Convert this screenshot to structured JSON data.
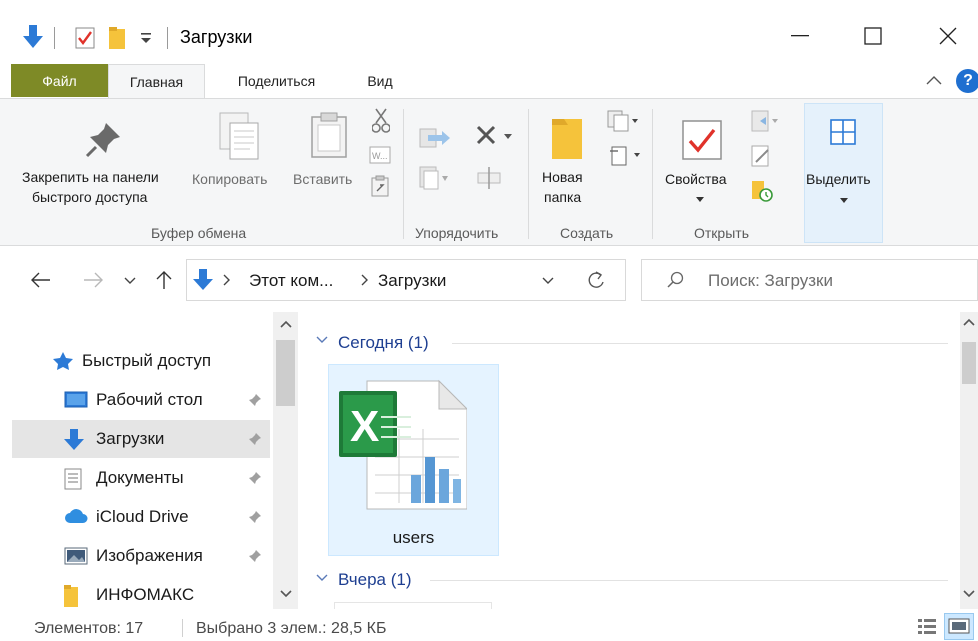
{
  "window": {
    "title": "Загрузки"
  },
  "quick_access_toolbar": {
    "items": [
      "properties-icon",
      "new-folder-icon",
      "customize-chevron-icon"
    ]
  },
  "tabs": [
    {
      "label": "Файл",
      "active": false,
      "accent": "#7e8a26"
    },
    {
      "label": "Главная",
      "active": true
    },
    {
      "label": "Поделиться",
      "active": false
    },
    {
      "label": "Вид",
      "active": false
    }
  ],
  "ribbon": {
    "clipboard": {
      "group_label": "Буфер обмена",
      "pin_label_1": "Закрепить на панели",
      "pin_label_2": "быстрого доступа",
      "copy_label": "Копировать",
      "paste_label": "Вставить"
    },
    "organize": {
      "group_label": "Упорядочить"
    },
    "new": {
      "group_label": "Создать",
      "new_folder_label_1": "Новая",
      "new_folder_label_2": "папка"
    },
    "open": {
      "group_label": "Открыть",
      "properties_label": "Свойства"
    },
    "select": {
      "select_label": "Выделить"
    }
  },
  "address": {
    "crumbs": [
      "Этот ком...",
      "Загрузки"
    ],
    "search_placeholder": "Поиск: Загрузки"
  },
  "nav_pane": {
    "quick_access": "Быстрый доступ",
    "items": [
      {
        "label": "Рабочий стол",
        "icon": "desktop-icon",
        "pinned": true,
        "selected": false
      },
      {
        "label": "Загрузки",
        "icon": "download-arrow-icon",
        "pinned": true,
        "selected": true
      },
      {
        "label": "Документы",
        "icon": "documents-icon",
        "pinned": true,
        "selected": false
      },
      {
        "label": "iCloud Drive",
        "icon": "cloud-icon",
        "pinned": true,
        "selected": false
      },
      {
        "label": "Изображения",
        "icon": "pictures-icon",
        "pinned": true,
        "selected": false
      },
      {
        "label": "ИНФОМАКС",
        "icon": "folder-icon",
        "pinned": false,
        "selected": false
      }
    ]
  },
  "content": {
    "groups": [
      {
        "label": "Сегодня (1)"
      },
      {
        "label": "Вчера (1)"
      }
    ],
    "files": [
      {
        "name": "users",
        "icon": "excel-file-icon",
        "selected": true
      }
    ]
  },
  "status": {
    "count": "Элементов: 17",
    "selection": "Выбрано 3 элем.: 28,5 КБ"
  },
  "colors": {
    "file_tab": "#7e8a26",
    "link_blue": "#1e3f91",
    "accent_blue": "#2c7ad6",
    "selection": "#e5f3ff"
  }
}
